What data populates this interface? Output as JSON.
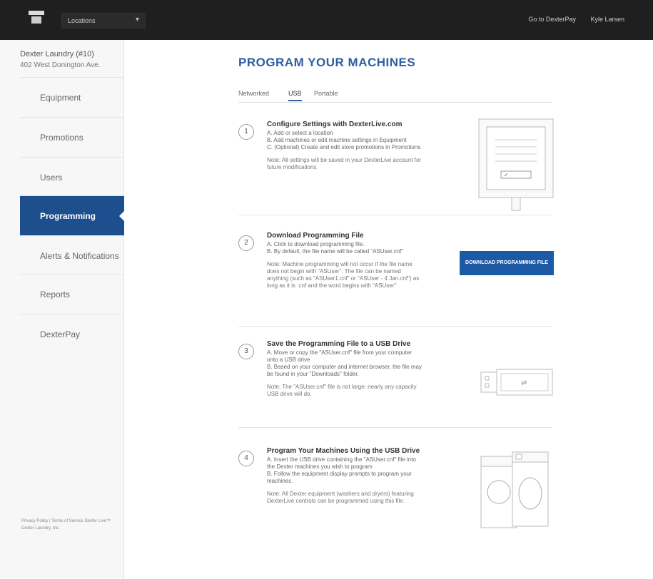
{
  "topbar": {
    "location_label": "Locations",
    "link_dexterpay": "Go to DexterPay",
    "user_name": "Kyle Larsen"
  },
  "sidebar": {
    "store_name": "Dexter Laundry (#10)",
    "store_address": "402 West Donington Ave.",
    "items": [
      {
        "label": "Equipment"
      },
      {
        "label": "Promotions"
      },
      {
        "label": "Users"
      },
      {
        "label": "Programming"
      },
      {
        "label": "Alerts & Notifications"
      },
      {
        "label": "Reports"
      },
      {
        "label": "DexterPay"
      }
    ],
    "footer": "Privacy Policy | Terms of Service Dexter Live™ Dexter Laundry, Inc."
  },
  "main": {
    "title": "PROGRAM YOUR MACHINES",
    "tabs": [
      "Networked",
      "USB",
      "Portable"
    ],
    "active_tab": "USB",
    "steps": [
      {
        "num": "1",
        "heading": "Configure Settings with DexterLive.com",
        "lines": [
          "A. Add or select a location",
          "B. Add machines or edit machine settings in Equipment",
          "C. (Optional) Create and edit store promotions in Promotions"
        ],
        "note": "Note: All settings will be saved in your DexterLive account for future modifications."
      },
      {
        "num": "2",
        "heading": "Download Programming File",
        "lines": [
          "A. Click to download programming file.",
          "B. By default, the file name will be called \"ASUser.cnf\""
        ],
        "note": "Note: Machine programming will not occur if the file name does not begin with \"ASUser\". The file can be named anything (such as \"ASUser1.cnf\" or \"ASUser - 4 Jan.cnf\") as long as it is .cnf and the word begins with \"ASUser\"",
        "button": "DOWNLOAD PROGRAMMING FILE"
      },
      {
        "num": "3",
        "heading": "Save the Programming File to a USB Drive",
        "lines": [
          "A. Move or copy the \"ASUser.cnf\" file from your computer onto a USB drive",
          "B. Based on your computer and internet browser, the file may be found in your \"Downloads\" folder."
        ],
        "note": "Note: The \"ASUser.cnf\" file is not large; nearly any capacity USB drive will do."
      },
      {
        "num": "4",
        "heading": "Program Your Machines Using the USB Drive",
        "lines": [
          "A. Insert the USB drive containing the \"ASUser.cnf\" file into the Dexter machines you wish to program",
          "B. Follow the equipment display prompts to program your machines."
        ],
        "note": "Note: All Dexter equipment (washers and dryers) featuring DexterLive controls can be programmed using this file."
      }
    ]
  }
}
